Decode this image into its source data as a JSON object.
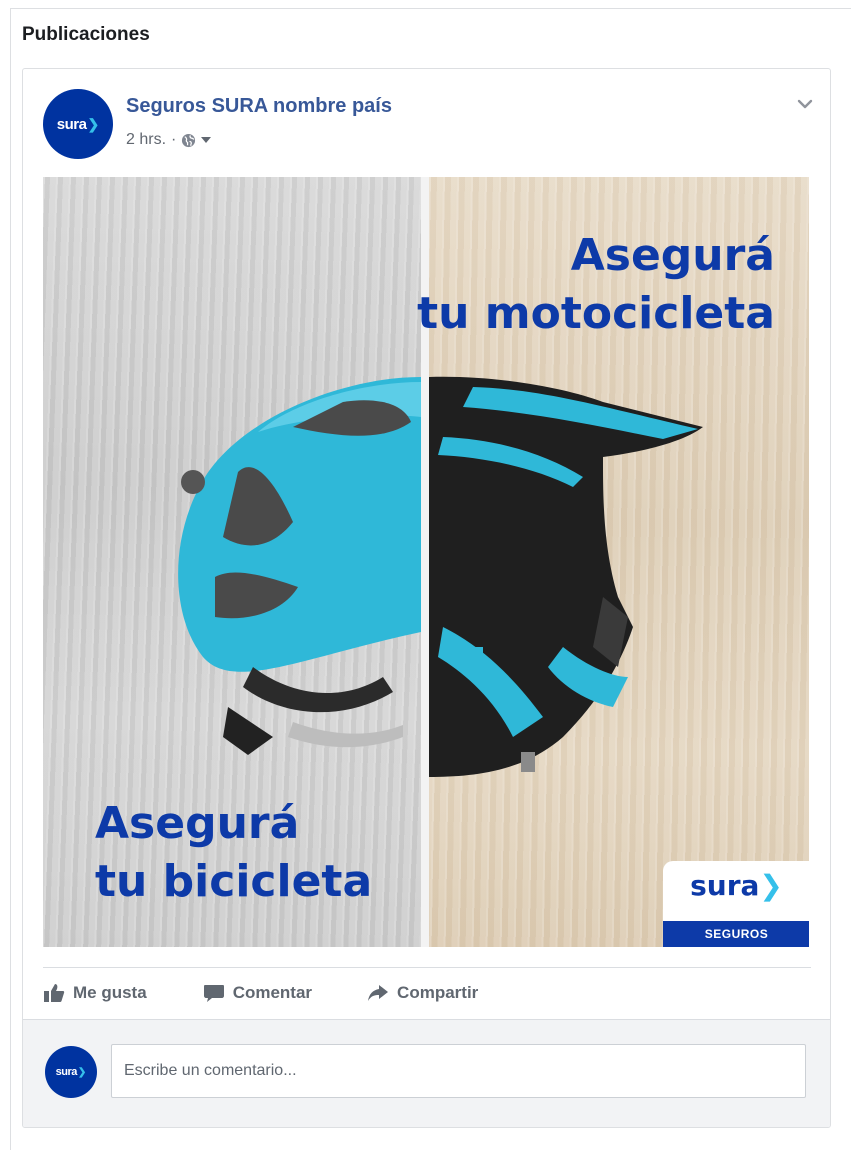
{
  "section": {
    "title": "Publicaciones"
  },
  "post": {
    "author": "Seguros SURA nombre país",
    "time": "2 hrs.",
    "separator": "·",
    "avatar_logo": "sura",
    "creative": {
      "headline_moto_line1": "Asegurá",
      "headline_moto_line2": "tu motocicleta",
      "headline_bici_line1": "Asegurá",
      "headline_bici_line2": "tu bicicleta",
      "badge_logo": "sura",
      "badge_label": "SEGUROS"
    },
    "actions": {
      "like": "Me gusta",
      "comment": "Comentar",
      "share": "Compartir"
    },
    "comment_box": {
      "avatar_logo": "sura",
      "placeholder": "Escribe un comentario..."
    }
  },
  "colors": {
    "brand_blue": "#0d3aa8",
    "brand_cyan": "#35c0ea",
    "link_blue": "#385898"
  },
  "icons": [
    "globe-icon",
    "caret-down-icon",
    "chevron-down-icon",
    "thumbs-up-icon",
    "comment-icon",
    "share-icon"
  ]
}
